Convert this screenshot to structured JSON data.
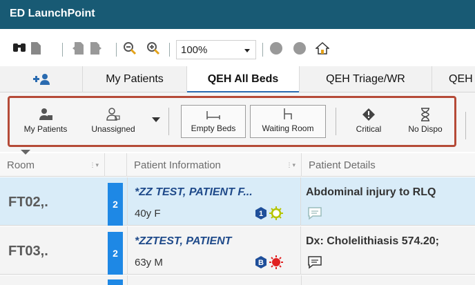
{
  "app": {
    "title": "ED LaunchPoint"
  },
  "toolbar": {
    "icons": [
      "binoculars-icon",
      "document-icon",
      "back-icon",
      "forward-icon",
      "zoom-out-icon",
      "zoom-in-icon",
      "circle-icon",
      "circle-icon",
      "home-icon"
    ],
    "zoom_value": "100%"
  },
  "tabs": [
    {
      "label": "",
      "icon": "add-person-icon"
    },
    {
      "label": "My Patients"
    },
    {
      "label": "QEH All Beds",
      "active": true
    },
    {
      "label": "QEH Triage/WR"
    },
    {
      "label": "QEH"
    }
  ],
  "filters": {
    "my_patients": "My Patients",
    "unassigned": "Unassigned",
    "empty_beds": "Empty Beds",
    "waiting_room": "Waiting Room",
    "critical": "Critical",
    "no_dispo": "No Dispo"
  },
  "table": {
    "headers": {
      "room": "Room",
      "patient_info": "Patient Information",
      "patient_details": "Patient Details"
    },
    "rows": [
      {
        "room": "FT02,.",
        "acuity": "2",
        "name": "*ZZ TEST, PATIENT F...",
        "demo": "40y F",
        "badge": "1",
        "details": "Abdominal injury to RLQ"
      },
      {
        "room": "FT03,.",
        "acuity": "2",
        "name": "*ZZTEST, PATIENT",
        "demo": "63y M",
        "badge": "B",
        "details": "Dx: Cholelithiasis 574.20;"
      }
    ]
  },
  "colors": {
    "titlebar": "#185a74",
    "acuity": "#1e88e5",
    "highlight": "#b54a37",
    "selected_row": "#d9ecf8"
  }
}
